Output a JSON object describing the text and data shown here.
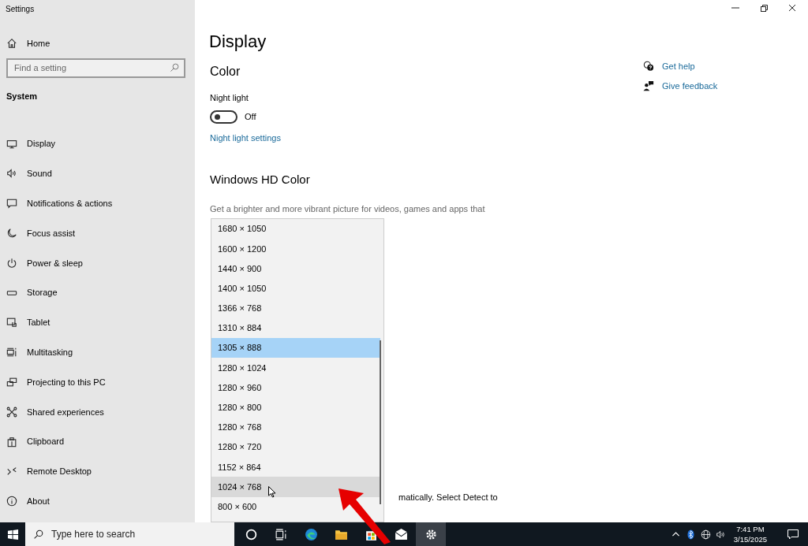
{
  "window": {
    "title": "Settings"
  },
  "sidebar": {
    "home": "Home",
    "search": {
      "placeholder": "Find a setting"
    },
    "section": "System",
    "items": [
      {
        "label": "Display"
      },
      {
        "label": "Sound"
      },
      {
        "label": "Notifications & actions"
      },
      {
        "label": "Focus assist"
      },
      {
        "label": "Power & sleep"
      },
      {
        "label": "Storage"
      },
      {
        "label": "Tablet"
      },
      {
        "label": "Multitasking"
      },
      {
        "label": "Projecting to this PC"
      },
      {
        "label": "Shared experiences"
      },
      {
        "label": "Clipboard"
      },
      {
        "label": "Remote Desktop"
      },
      {
        "label": "About"
      }
    ]
  },
  "main": {
    "title": "Display",
    "color_heading": "Color",
    "night_light": {
      "label": "Night light",
      "on": false,
      "state_text": "Off"
    },
    "night_light_link": "Night light settings",
    "hd_heading": "Windows HD Color",
    "hd_description": "Get a brighter and more vibrant picture for videos, games and apps that",
    "partial_text": "matically. Select Detect to"
  },
  "help_links": [
    {
      "label": "Get help"
    },
    {
      "label": "Give feedback"
    }
  ],
  "resolution_dropdown": [
    {
      "label": "1680 × 1050",
      "selected": false,
      "hovered": false
    },
    {
      "label": "1600 × 1200",
      "selected": false,
      "hovered": false
    },
    {
      "label": "1440 × 900",
      "selected": false,
      "hovered": false
    },
    {
      "label": "1400 × 1050",
      "selected": false,
      "hovered": false
    },
    {
      "label": "1366 × 768",
      "selected": false,
      "hovered": false
    },
    {
      "label": "1310 × 884",
      "selected": false,
      "hovered": false
    },
    {
      "label": "1305 × 888",
      "selected": true,
      "hovered": false
    },
    {
      "label": "1280 × 1024",
      "selected": false,
      "hovered": false
    },
    {
      "label": "1280 × 960",
      "selected": false,
      "hovered": false
    },
    {
      "label": "1280 × 800",
      "selected": false,
      "hovered": false
    },
    {
      "label": "1280 × 768",
      "selected": false,
      "hovered": false
    },
    {
      "label": "1280 × 720",
      "selected": false,
      "hovered": false
    },
    {
      "label": "1152 × 864",
      "selected": false,
      "hovered": false
    },
    {
      "label": "1024 × 768",
      "selected": false,
      "hovered": true
    },
    {
      "label": "800 × 600",
      "selected": false,
      "hovered": false
    }
  ],
  "taskbar": {
    "search_placeholder": "Type here to search",
    "apps": [
      {
        "active": false
      },
      {
        "active": false
      },
      {
        "active": false
      },
      {
        "active": false
      },
      {
        "active": false
      },
      {
        "active": false
      },
      {
        "active": true
      }
    ],
    "time": "7:41 PM",
    "date": "3/15/2025"
  }
}
